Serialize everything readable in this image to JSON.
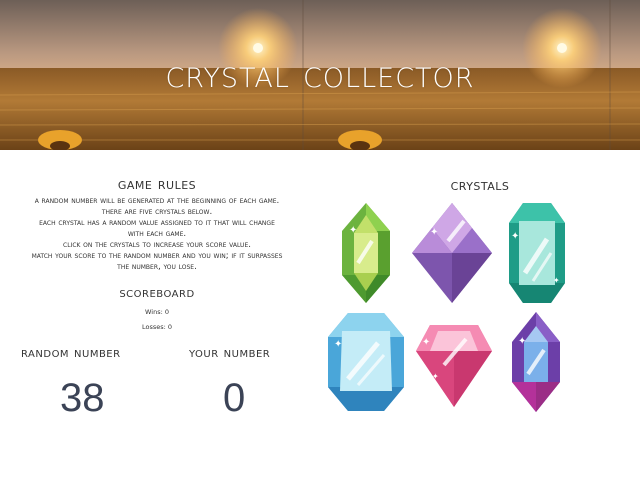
{
  "header": {
    "title": "Crystal Collector"
  },
  "rules": {
    "title": "Game Rules",
    "lines": [
      "A random number will be generated at the beginning of each game.",
      "There are five crystals below.",
      "Each crystal has a random value assigned to it that will change",
      "with each game.",
      "Click on the crystals to increase your score value.",
      "Match your score to the random number and you win; if it surpasses",
      "the number, you lose."
    ]
  },
  "scoreboard": {
    "title": "Scoreboard",
    "wins": "Wins: 0",
    "losses": "Losses: 0"
  },
  "random": {
    "label": "Random Number",
    "value": "38"
  },
  "yours": {
    "label": "Your Number",
    "value": "0"
  },
  "crystals": {
    "title": "Crystals",
    "items": [
      {
        "icon": "green-crystal-icon",
        "color": "#8cc63f"
      },
      {
        "icon": "purple-crystal-icon",
        "color": "#8e63b6"
      },
      {
        "icon": "teal-crystal-icon",
        "color": "#2bb39b"
      },
      {
        "icon": "blue-crystal-icon",
        "color": "#5bb7e2"
      },
      {
        "icon": "pink-crystal-icon",
        "color": "#e8578e"
      },
      {
        "icon": "violet-crystal-icon",
        "color": "#7a4ab0"
      }
    ]
  }
}
